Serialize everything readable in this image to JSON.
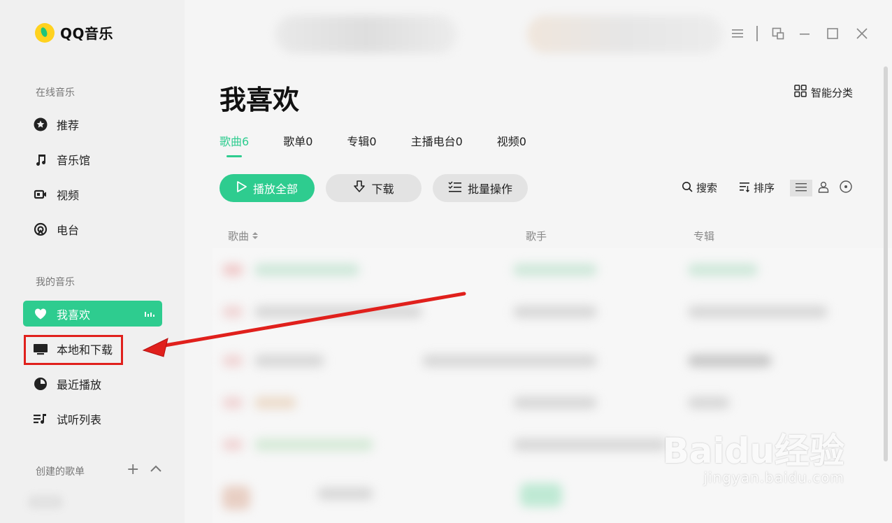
{
  "app": {
    "name": "QQ音乐"
  },
  "sidebar": {
    "sections": {
      "online": "在线音乐",
      "mine": "我的音乐",
      "created": "创建的歌单"
    },
    "online_items": [
      {
        "label": "推荐",
        "icon": "star-circle-icon"
      },
      {
        "label": "音乐馆",
        "icon": "music-note-icon"
      },
      {
        "label": "视频",
        "icon": "video-icon"
      },
      {
        "label": "电台",
        "icon": "radio-icon"
      }
    ],
    "my_items": [
      {
        "label": "我喜欢",
        "icon": "heart-icon",
        "active": true
      },
      {
        "label": "本地和下载",
        "icon": "monitor-icon"
      },
      {
        "label": "最近播放",
        "icon": "clock-icon"
      },
      {
        "label": "试听列表",
        "icon": "playlist-icon"
      }
    ]
  },
  "main": {
    "title": "我喜欢",
    "smart_sort": "智能分类",
    "tabs": [
      {
        "label": "歌曲6",
        "active": true
      },
      {
        "label": "歌单0"
      },
      {
        "label": "专辑0"
      },
      {
        "label": "主播电台0"
      },
      {
        "label": "视频0"
      }
    ],
    "actions": {
      "play_all": "播放全部",
      "download": "下载",
      "batch": "批量操作",
      "search": "搜索",
      "sort": "排序"
    },
    "columns": {
      "song": "歌曲",
      "singer": "歌手",
      "album": "专辑"
    }
  },
  "watermark": {
    "main": "Baidu经验",
    "sub": "jingyan.baidu.com"
  },
  "colors": {
    "accent": "#2ecc8f",
    "highlight": "#e0201c"
  }
}
